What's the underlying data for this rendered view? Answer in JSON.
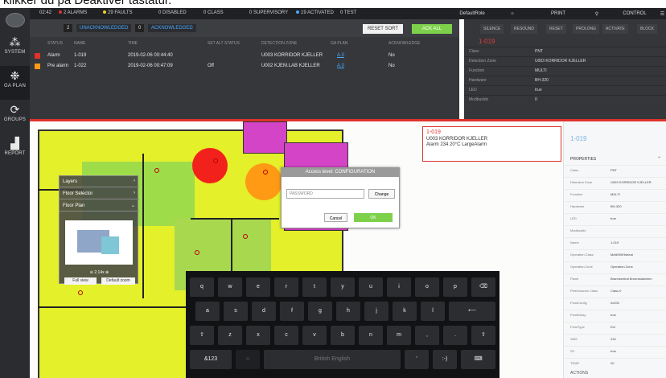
{
  "caption": "klikker du på Deaktiver tastatur.",
  "sidebar": {
    "items": [
      {
        "label": "SYSTEM",
        "icon": "system-icon"
      },
      {
        "label": "GA PLAN",
        "icon": "plan-icon"
      },
      {
        "label": "GROUPS",
        "icon": "groups-icon"
      },
      {
        "label": "REPORT",
        "icon": "report-icon"
      }
    ]
  },
  "topbar": {
    "time": "02:42",
    "alarms": "2 ALARMS",
    "faults": "29 FAULTS",
    "disabled": "0 DISABLED",
    "class": "0 CLASS",
    "supervisory": "0 SUPERVISORY",
    "activated": "19 ACTIVATED",
    "test": "0 TEST",
    "role": "DefaultRole",
    "print": "PRINT",
    "control": "CONTROL"
  },
  "alarm_panel": {
    "unacknowledged_count": "2",
    "unacknowledged_label": "UNACKNOWLEDGED",
    "acknowledged_count": "0",
    "acknowledged_label": "ACKNOWLEDGED",
    "reset_sort": "RESET SORT",
    "ack_all": "ACK ALL",
    "columns": [
      "STATUS",
      "NAME",
      "TIME",
      "SET ALT STATUS",
      "DETECTION ZONE",
      "GA PLAN",
      "ACKNOWLEDGE"
    ],
    "rows": [
      {
        "status": "Alarm",
        "name": "1-019",
        "time": "2019-02-06 00:44:40",
        "alt": "",
        "zone": "U003 KORRIDOR KJELLER",
        "plan": "A.0",
        "ack": "No"
      },
      {
        "status": "Pre alarm",
        "name": "1-022",
        "time": "2019-02-06 00:47:09",
        "alt": "Off",
        "zone": "U002 KJEM.LAB KJELLER",
        "plan": "A.0",
        "ack": "No"
      }
    ]
  },
  "prop_dark": {
    "tabs": [
      "SILENCE",
      "RESOUND",
      "RESET",
      "PROLONG",
      "ACTIVATE",
      "BLOCK"
    ],
    "title": "1-019",
    "rows": [
      {
        "k": "Class",
        "v": "PNT"
      },
      {
        "k": "Detection Zone",
        "v": "U003 KORRIDOR KJELLER"
      },
      {
        "k": "Function",
        "v": "MULTI"
      },
      {
        "k": "Hardware",
        "v": "BH-320"
      },
      {
        "k": "LED",
        "v": "true"
      },
      {
        "k": "Modbusldx",
        "v": "0"
      }
    ]
  },
  "layers_panel": {
    "layers": "Layers",
    "floor_selector": "Floor Selector",
    "floor_plan": "Floor Plan",
    "zoom": "2.14x",
    "full_view": "Full view",
    "default_zoom": "Default zoom"
  },
  "access_dialog": {
    "title": "Access level: CONFIGURATION",
    "password_placeholder": "PASSWORD",
    "change": "Change",
    "cancel": "Cancel",
    "ok": "OK"
  },
  "tooltip": {
    "id": "1-019",
    "zone": "U003 KORRIDOR KJELLER",
    "alarm": "Alarm 234 20°C LargeAlarm"
  },
  "keyboard": {
    "row1": [
      "q",
      "w",
      "e",
      "r",
      "t",
      "y",
      "u",
      "i",
      "o",
      "p",
      "⌫"
    ],
    "row2": [
      "a",
      "s",
      "d",
      "f",
      "g",
      "h",
      "j",
      "k",
      "l",
      "⟵"
    ],
    "row3": [
      "⇧",
      "z",
      "x",
      "c",
      "v",
      "b",
      "n",
      "m",
      ",",
      ".",
      "⇧"
    ],
    "row4": [
      "&123",
      "☺",
      "British English",
      "'",
      ":-)",
      "⌨"
    ]
  },
  "properties": {
    "id": "1-019",
    "section": "PROPERTIES",
    "actions": "ACTIONS",
    "rows": [
      {
        "k": "Class",
        "v": "PNT"
      },
      {
        "k": "Detection Zone",
        "v": "U003 KORRIDOR KJELLER"
      },
      {
        "k": "Function",
        "v": "MULTI"
      },
      {
        "k": "Hardware",
        "v": "BH-320"
      },
      {
        "k": "LED",
        "v": "true"
      },
      {
        "k": "Modbusldx",
        "v": ""
      },
      {
        "k": "Name",
        "v": "1-019"
      },
      {
        "k": "Operation Class",
        "v": "Multi900Hsheat"
      },
      {
        "k": "Operation Zone",
        "v": "Operation Zone"
      },
      {
        "k": "Panel",
        "v": "Brannsentral Bronnstadveien"
      },
      {
        "k": "Performance Class",
        "v": "Class 0"
      },
      {
        "k": "PointConfig",
        "v": "0x200"
      },
      {
        "k": "PointDelay",
        "v": "true"
      },
      {
        "k": "PointType",
        "v": "Ext"
      },
      {
        "k": "SMS",
        "v": "234"
      },
      {
        "k": "SV",
        "v": "true"
      },
      {
        "k": "TEMP",
        "v": "20"
      }
    ]
  },
  "colors": {
    "alarm_red": "#e0322d",
    "ok_green": "#7dd14a",
    "floor_yellow": "#e3f02a",
    "zone_magenta": "#d444c7"
  }
}
